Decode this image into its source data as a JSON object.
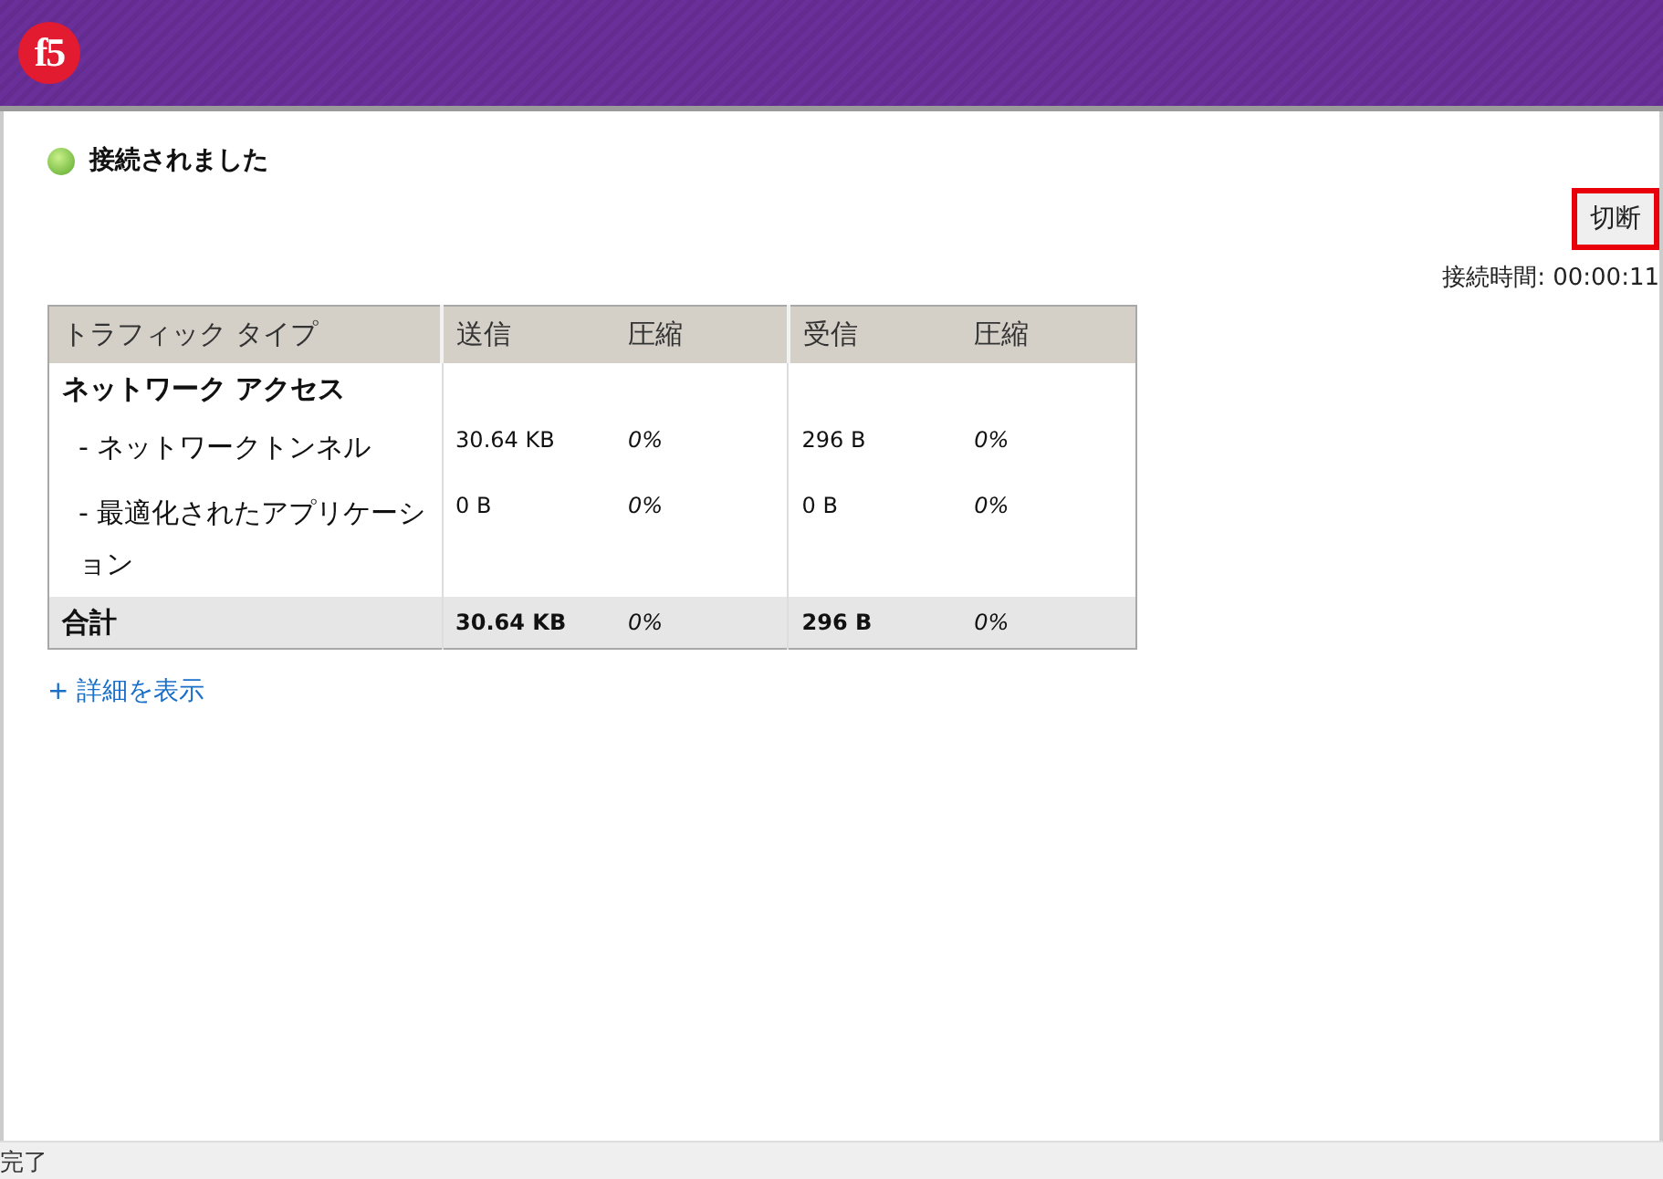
{
  "header": {
    "logo": "f5"
  },
  "status": {
    "text": "接続されました",
    "connected": true
  },
  "disconnect_button": {
    "label": "切断",
    "highlighted": true
  },
  "connection_time": "接続時間: 00:00:11",
  "table": {
    "columns": [
      "トラフィック タイプ",
      "送信",
      "圧縮",
      "受信",
      "圧縮"
    ],
    "rows": [
      {
        "kind": "group",
        "cells": [
          "ネットワーク アクセス",
          "",
          "",
          "",
          ""
        ]
      },
      {
        "kind": "item",
        "cells": [
          "- ネットワークトンネル",
          "30.64 KB",
          "0%",
          "296 B",
          "0%"
        ]
      },
      {
        "kind": "item",
        "cells": [
          "- 最適化されたアプリケーション",
          "0 B",
          "0%",
          "0 B",
          "0%"
        ]
      },
      {
        "kind": "total",
        "cells": [
          "合計",
          "30.64 KB",
          "0%",
          "296 B",
          "0%"
        ]
      }
    ]
  },
  "details_link": "+ 詳細を表示",
  "status_bar": "完了"
}
